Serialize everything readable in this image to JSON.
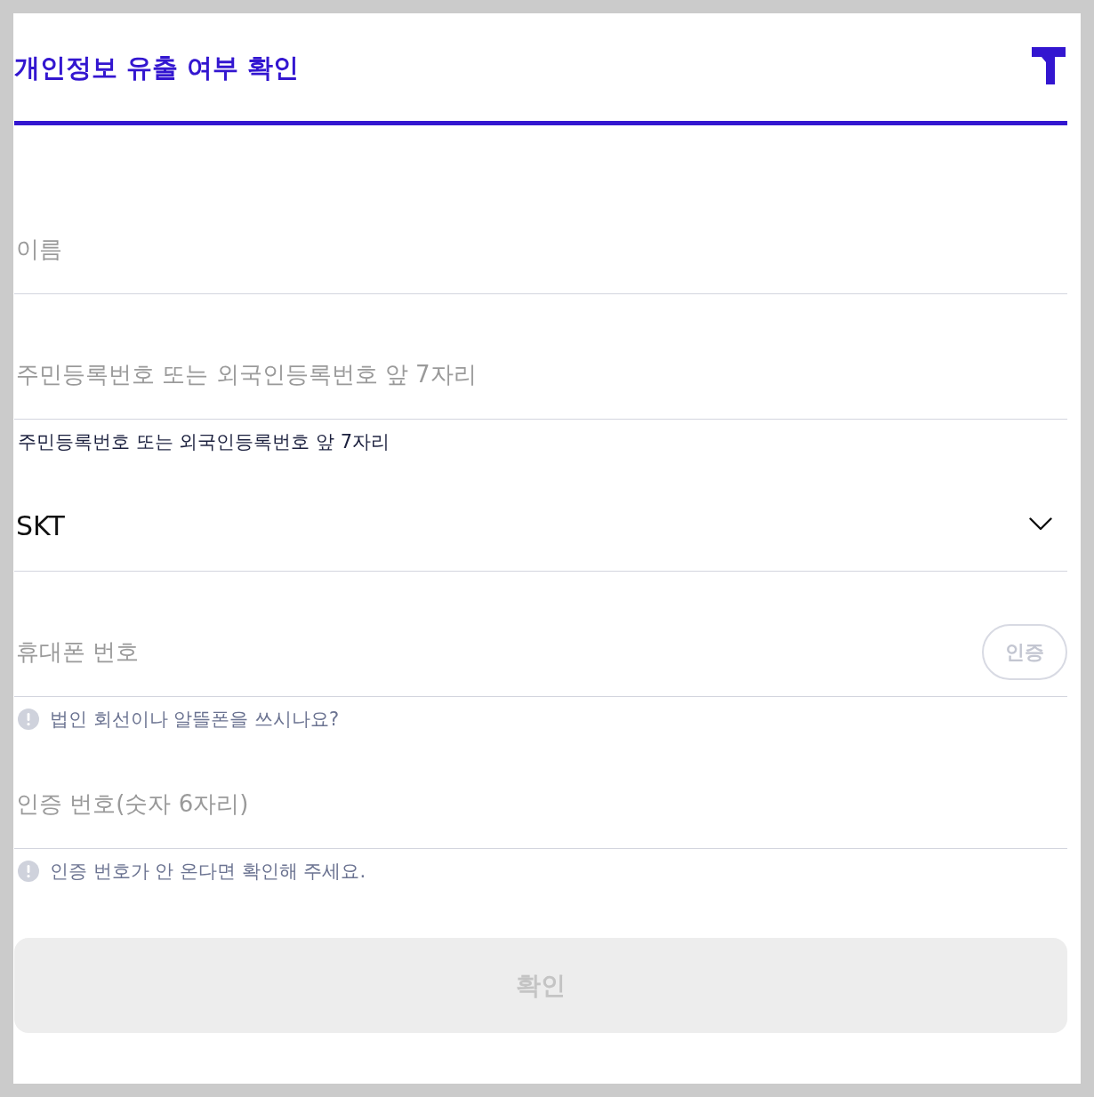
{
  "header": {
    "title": "개인정보 유출 여부 확인"
  },
  "fields": [
    {
      "kind": "text",
      "placeholder": "이름"
    },
    {
      "kind": "text",
      "placeholder": "주민등록번호 또는 외국인등록번호 앞 7자리",
      "helper": "주민등록번호 또는 외국인등록번호 앞 7자리"
    },
    {
      "kind": "select",
      "value": "SKT"
    },
    {
      "kind": "text",
      "placeholder": "휴대폰 번호",
      "action": {
        "label": "인증",
        "disabled": true
      },
      "notice": "법인 회선이나 알뜰폰을 쓰시나요?"
    },
    {
      "kind": "text",
      "placeholder": "인증 번호(숫자 6자리)",
      "notice": "인증 번호가 안 온다면 확인해 주세요."
    }
  ],
  "submit": {
    "label": "확인",
    "disabled": true
  }
}
